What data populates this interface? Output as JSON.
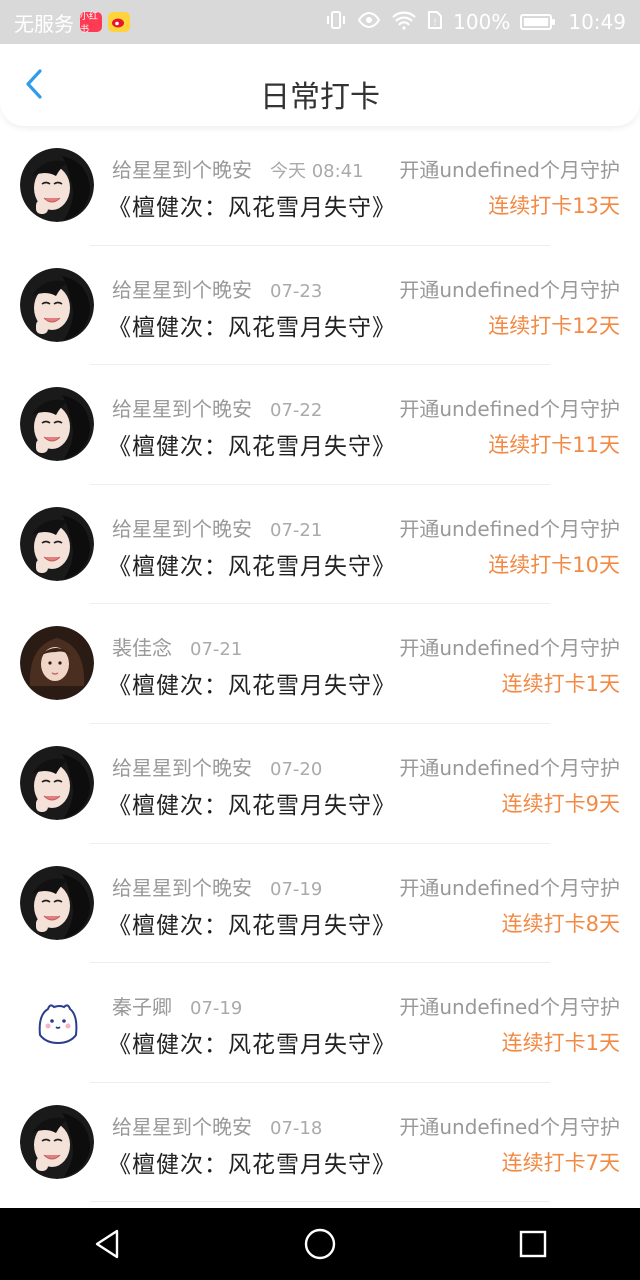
{
  "status_bar": {
    "carrier": "无服务",
    "app_badge_text": "小红书",
    "battery_level": "100%",
    "time": "10:49",
    "icons": [
      "vibrate-icon",
      "eye-icon",
      "wifi-icon",
      "sim-icon",
      "battery-icon"
    ]
  },
  "header": {
    "title": "日常打卡",
    "back_icon": "chevron-left-icon"
  },
  "items": [
    {
      "username": "给星星到个晚安",
      "date": "今天 08:41",
      "guard": "开通undefined个月守护",
      "book": "《檀健次：风花雪月失守》",
      "streak": "连续打卡13天",
      "avatar": "girl-dark-hair"
    },
    {
      "username": "给星星到个晚安",
      "date": "07-23",
      "guard": "开通undefined个月守护",
      "book": "《檀健次：风花雪月失守》",
      "streak": "连续打卡12天",
      "avatar": "girl-dark-hair"
    },
    {
      "username": "给星星到个晚安",
      "date": "07-22",
      "guard": "开通undefined个月守护",
      "book": "《檀健次：风花雪月失守》",
      "streak": "连续打卡11天",
      "avatar": "girl-dark-hair"
    },
    {
      "username": "给星星到个晚安",
      "date": "07-21",
      "guard": "开通undefined个月守护",
      "book": "《檀健次：风花雪月失守》",
      "streak": "连续打卡10天",
      "avatar": "girl-dark-hair"
    },
    {
      "username": "裴佳念",
      "date": "07-21",
      "guard": "开通undefined个月守护",
      "book": "《檀健次：风花雪月失守》",
      "streak": "连续打卡1天",
      "avatar": "girl-brown-hair"
    },
    {
      "username": "给星星到个晚安",
      "date": "07-20",
      "guard": "开通undefined个月守护",
      "book": "《檀健次：风花雪月失守》",
      "streak": "连续打卡9天",
      "avatar": "girl-dark-hair"
    },
    {
      "username": "给星星到个晚安",
      "date": "07-19",
      "guard": "开通undefined个月守护",
      "book": "《檀健次：风花雪月失守》",
      "streak": "连续打卡8天",
      "avatar": "girl-dark-hair"
    },
    {
      "username": "秦子卿",
      "date": "07-19",
      "guard": "开通undefined个月守护",
      "book": "《檀健次：风花雪月失守》",
      "streak": "连续打卡1天",
      "avatar": "cartoon-bear"
    },
    {
      "username": "给星星到个晚安",
      "date": "07-18",
      "guard": "开通undefined个月守护",
      "book": "《檀健次：风花雪月失守》",
      "streak": "连续打卡7天",
      "avatar": "girl-dark-hair"
    }
  ],
  "colors": {
    "accent_orange": "#f28a45",
    "back_blue": "#2f9bea",
    "status_bar_bg": "#d9d9d9",
    "nav_bar_bg": "#000000"
  },
  "system_nav": {
    "buttons": [
      "back-triangle-icon",
      "home-circle-icon",
      "recents-square-icon"
    ]
  }
}
